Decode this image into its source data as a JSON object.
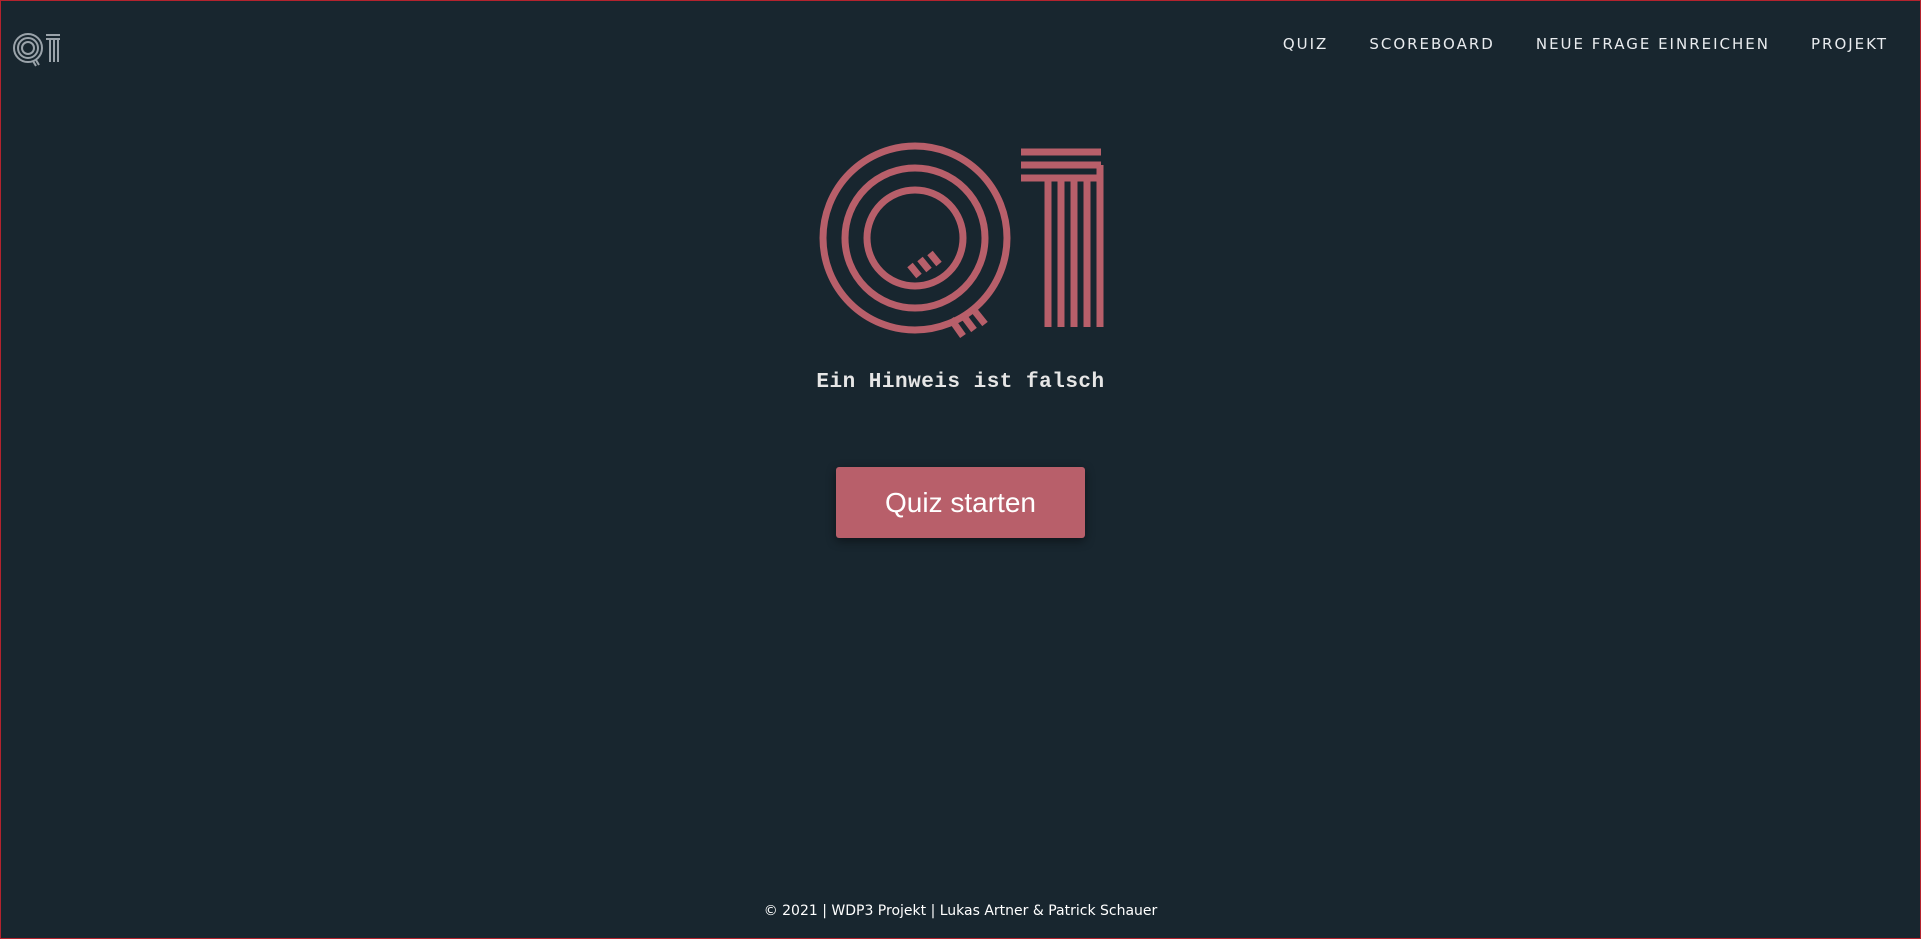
{
  "header": {
    "logo_icon": "q1-logo-icon",
    "nav": [
      {
        "label": "QUIZ"
      },
      {
        "label": "SCOREBOARD"
      },
      {
        "label": "NEUE FRAGE EINREICHEN"
      },
      {
        "label": "PROJEKT"
      }
    ]
  },
  "hero": {
    "logo_icon": "q1-logo-icon",
    "subtitle": "Ein Hinweis ist falsch",
    "start_button_label": "Quiz starten"
  },
  "footer": {
    "text": "© 2021 | WDP3 Projekt | Lukas Artner & Patrick Schauer"
  },
  "colors": {
    "background": "#18262f",
    "accent": "#b85f6a",
    "nav_logo": "#9aa3aa",
    "text": "#e9ecef"
  }
}
